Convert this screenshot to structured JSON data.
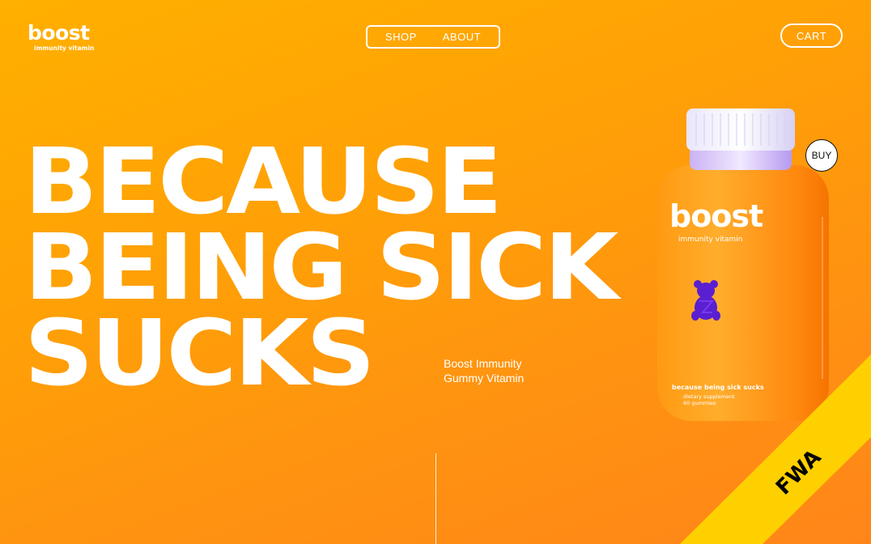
{
  "brand": {
    "name": "boost",
    "tagline": "immunity vitamin"
  },
  "nav": {
    "shop": "SHOP",
    "about": "ABOUT",
    "cart": "CART"
  },
  "hero": {
    "headline": [
      "BECAUSE",
      "BEING SICK",
      "SUCKS"
    ],
    "subtitle": [
      "Boost Immunity",
      "Gummy Vitamin"
    ]
  },
  "product": {
    "brand": "boost",
    "tagline": "immunity vitamin",
    "slogan": "because being sick sucks",
    "line1": "dietary supplement",
    "line2": "60 gummies",
    "buy_label": "BUY"
  },
  "badge": {
    "text": "FWA",
    "icon": "fwa-logo"
  },
  "colors": {
    "background": "#ffa205",
    "accent": "#ffd000",
    "gummy": "#5a1fd1"
  }
}
